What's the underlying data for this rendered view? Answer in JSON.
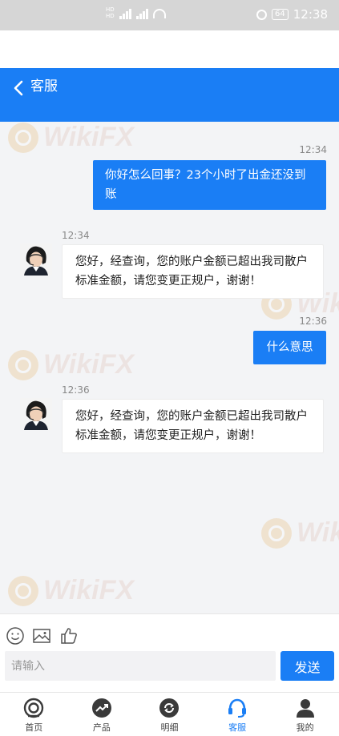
{
  "status_bar": {
    "time": "12:38",
    "battery": "64",
    "network_badges": [
      "HD",
      "HD"
    ]
  },
  "header": {
    "title": "客服"
  },
  "messages": [
    {
      "direction": "outgoing",
      "time": "12:34",
      "text": "你好怎么回事？23个小时了出金还没到账"
    },
    {
      "direction": "incoming",
      "time": "12:34",
      "text": "您好，经查询，您的账户金额已超出我司散户标准金额，请您变更正规户，谢谢！"
    },
    {
      "direction": "outgoing",
      "time": "12:36",
      "text": "什么意思"
    },
    {
      "direction": "incoming",
      "time": "12:36",
      "text": "您好，经查询，您的账户金额已超出我司散户标准金额，请您变更正规户，谢谢！"
    }
  ],
  "watermark": {
    "text": "WikiFX"
  },
  "composer": {
    "placeholder": "请输入",
    "value": "",
    "send_label": "发送"
  },
  "toolbar_icons": [
    "emoji-icon",
    "image-icon",
    "thumbs-up-icon"
  ],
  "tabs": [
    {
      "label": "首页",
      "icon": "home-icon",
      "active": false
    },
    {
      "label": "产品",
      "icon": "trend-icon",
      "active": false
    },
    {
      "label": "明细",
      "icon": "exchange-icon",
      "active": false
    },
    {
      "label": "客服",
      "icon": "headset-icon",
      "active": true
    },
    {
      "label": "我的",
      "icon": "user-icon",
      "active": false
    }
  ],
  "colors": {
    "primary": "#1a7ef5",
    "chat_bg": "#f3f4f6",
    "status_bar": "#d6d6d6"
  }
}
